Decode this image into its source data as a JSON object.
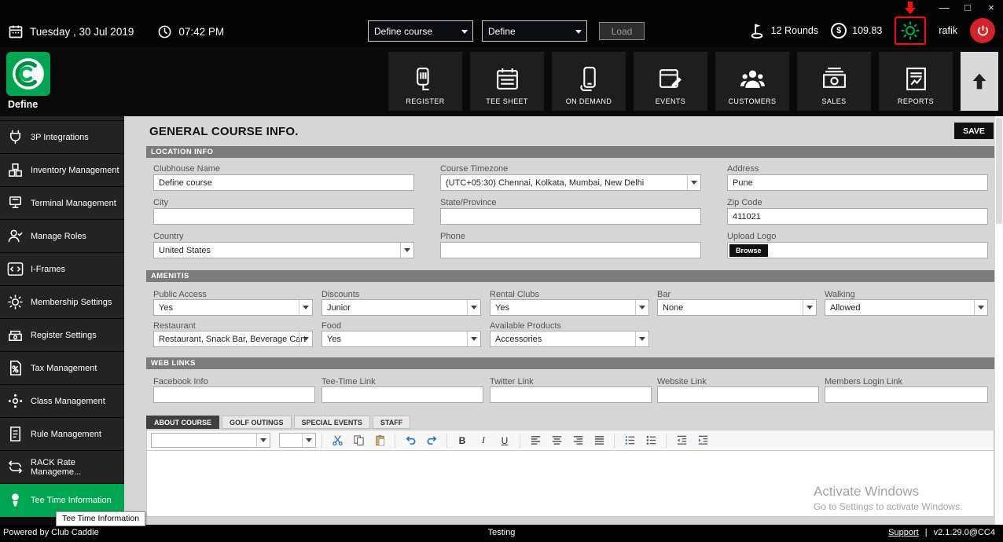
{
  "window_controls": {
    "minimize": "—",
    "maximize": "□",
    "close": "×"
  },
  "titlebar": {
    "date": "Tuesday ,  30 Jul 2019",
    "time": "07:42 PM",
    "course_dropdown": "Define course",
    "define_dropdown": "Define",
    "load_button": "Load",
    "rounds_label": "12 Rounds",
    "currency_symbol": "$",
    "balance": "109.83",
    "username": "rafik"
  },
  "nav": {
    "logo_label": "Define",
    "tiles": [
      {
        "label": "REGISTER"
      },
      {
        "label": "TEE SHEET"
      },
      {
        "label": "ON DEMAND"
      },
      {
        "label": "EVENTS"
      },
      {
        "label": "CUSTOMERS"
      },
      {
        "label": "SALES"
      },
      {
        "label": "REPORTS"
      }
    ]
  },
  "sidebar": {
    "items": [
      {
        "label": "3P Integrations"
      },
      {
        "label": "Inventory Management"
      },
      {
        "label": "Terminal Management"
      },
      {
        "label": "Manage Roles"
      },
      {
        "label": "I-Frames"
      },
      {
        "label": "Membership Settings"
      },
      {
        "label": "Register Settings"
      },
      {
        "label": "Tax Management"
      },
      {
        "label": "Class Management"
      },
      {
        "label": "Rule Management"
      },
      {
        "label": "RACK Rate Manageme..."
      },
      {
        "label": "Tee Time Information"
      }
    ],
    "active_item": "Tee Time Information",
    "tooltip": "Tee Time Information",
    "footer": "Powered by Club Caddie"
  },
  "page": {
    "title": "GENERAL COURSE INFO.",
    "save_button": "SAVE"
  },
  "location_info": {
    "header": "LOCATION INFO",
    "clubhouse_name": {
      "label": "Clubhouse Name",
      "value": "Define course"
    },
    "course_timezone": {
      "label": "Course Timezone",
      "value": "(UTC+05:30) Chennai, Kolkata, Mumbai, New Delhi"
    },
    "address": {
      "label": "Address",
      "value": "Pune"
    },
    "city": {
      "label": "City",
      "value": ""
    },
    "state": {
      "label": "State/Province",
      "value": ""
    },
    "zip": {
      "label": "Zip Code",
      "value": "411021"
    },
    "country": {
      "label": "Country",
      "value": "United States"
    },
    "phone": {
      "label": "Phone",
      "value": ""
    },
    "upload_logo": {
      "label": "Upload Logo",
      "browse": "Browse",
      "value": ""
    }
  },
  "amenities": {
    "header": "AMENITIS",
    "public_access": {
      "label": "Public Access",
      "value": "Yes"
    },
    "discounts": {
      "label": "Discounts",
      "value": "Junior"
    },
    "rental_clubs": {
      "label": "Rental Clubs",
      "value": "Yes"
    },
    "bar": {
      "label": "Bar",
      "value": "None"
    },
    "walking": {
      "label": "Walking",
      "value": "Allowed"
    },
    "restaurant": {
      "label": "Restaurant",
      "value": "Restaurant, Snack Bar, Beverage Cart"
    },
    "food": {
      "label": "Food",
      "value": "Yes"
    },
    "available_products": {
      "label": "Available Products",
      "value": "Accessories"
    }
  },
  "web_links": {
    "header": "WEB LINKS",
    "facebook": {
      "label": "Facebook Info",
      "value": ""
    },
    "teetime": {
      "label": "Tee-Time Link",
      "value": ""
    },
    "twitter": {
      "label": "Twitter Link",
      "value": ""
    },
    "website": {
      "label": "Website Link",
      "value": ""
    },
    "members": {
      "label": "Members Login Link",
      "value": ""
    }
  },
  "course_tabs": {
    "tabs": [
      {
        "label": "ABOUT COURSE"
      },
      {
        "label": "GOLF OUTINGS"
      },
      {
        "label": "SPECIAL EVENTS"
      },
      {
        "label": "STAFF"
      }
    ],
    "active": "ABOUT COURSE"
  },
  "editor": {
    "bold": "B",
    "italic": "I",
    "underline": "U"
  },
  "watermark": {
    "line1": "Activate Windows",
    "line2": "Go to Settings to activate Windows."
  },
  "statusbar": {
    "center": "Testing",
    "support": "Support",
    "separator": "|",
    "version": "v2.1.29.0@CC4"
  }
}
